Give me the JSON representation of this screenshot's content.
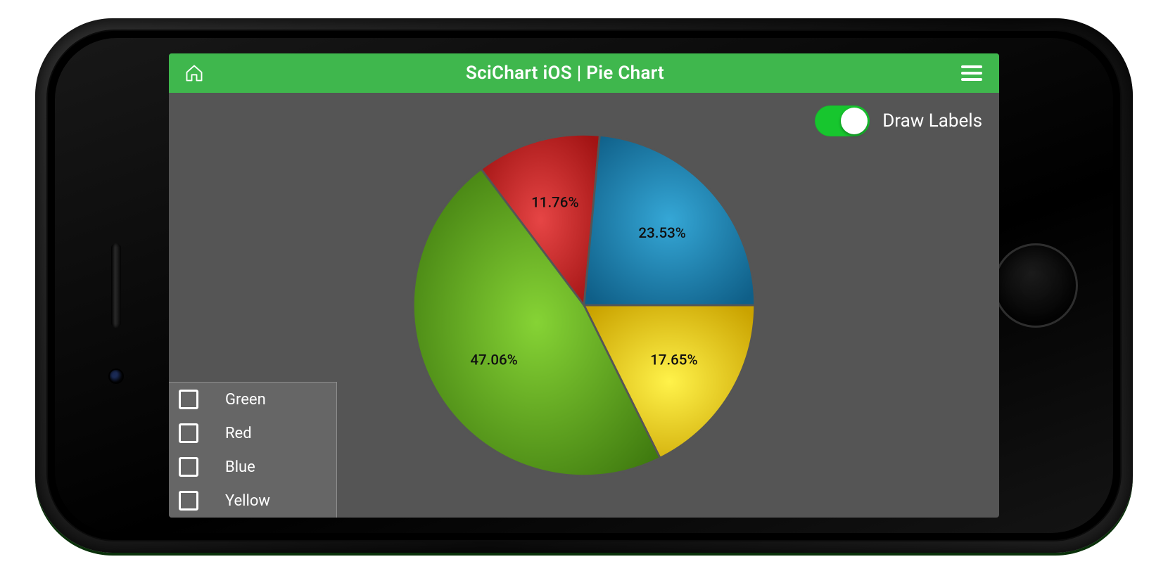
{
  "navbar": {
    "title": "SciChart iOS | Pie Chart"
  },
  "toggle": {
    "label": "Draw Labels",
    "on": true
  },
  "legend": {
    "items": [
      {
        "label": "Green"
      },
      {
        "label": "Red"
      },
      {
        "label": "Blue"
      },
      {
        "label": "Yellow"
      }
    ]
  },
  "colors": {
    "accent": "#3fb74d",
    "background": "#555555",
    "legend_bg": "#666666"
  },
  "chart_data": {
    "type": "pie",
    "title": "",
    "series": [
      {
        "name": "Yellow",
        "value": 17.65,
        "label": "17.65%",
        "color_light": "#fff24a",
        "color_dark": "#caa300"
      },
      {
        "name": "Green",
        "value": 47.06,
        "label": "47.06%",
        "color_light": "#86d335",
        "color_dark": "#3f7a0f"
      },
      {
        "name": "Red",
        "value": 11.76,
        "label": "11.76%",
        "color_light": "#e64545",
        "color_dark": "#a11313"
      },
      {
        "name": "Blue",
        "value": 23.53,
        "label": "23.53%",
        "color_light": "#35a7d6",
        "color_dark": "#0f5f88"
      }
    ]
  }
}
